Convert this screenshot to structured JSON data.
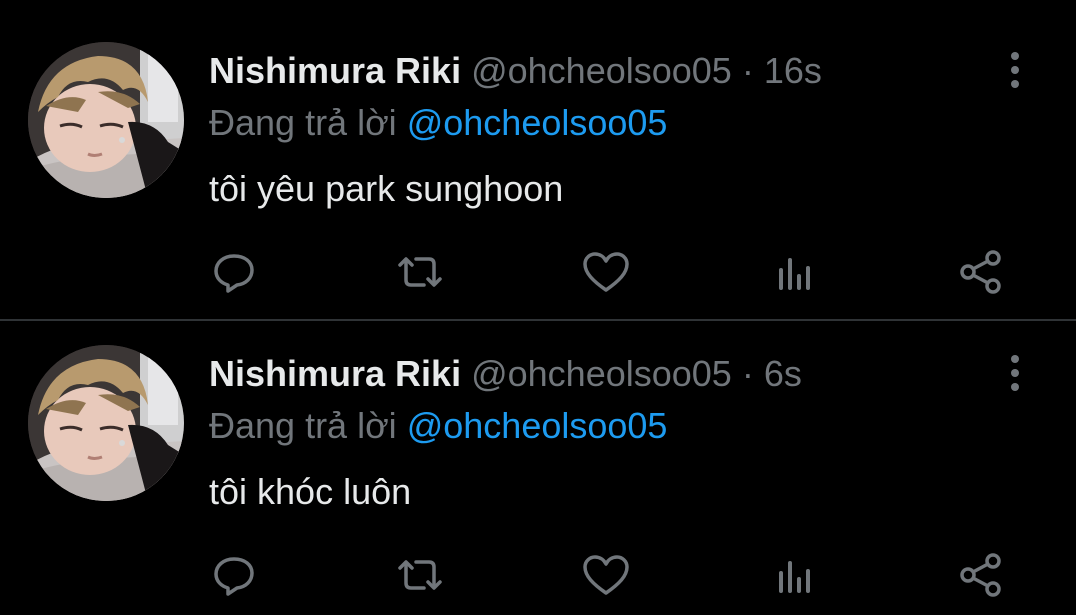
{
  "colors": {
    "background": "#000000",
    "primary_text": "#e7e9ea",
    "secondary_text": "#71767b",
    "mention": "#1d9bf0",
    "divider": "#2f3336"
  },
  "tweets": [
    {
      "author_name": "Nishimura Riki",
      "handle": "@ohcheolsoo05",
      "separator": "·",
      "time": "16s",
      "reply_prefix": "Đang trả lời",
      "reply_mention": "@ohcheolsoo05",
      "text": "tôi yêu park sunghoon",
      "avatar_icon": "user-avatar",
      "actions": [
        "reply-icon",
        "retweet-icon",
        "like-icon",
        "stats-icon",
        "share-icon"
      ]
    },
    {
      "author_name": "Nishimura Riki",
      "handle": "@ohcheolsoo05",
      "separator": "·",
      "time": "6s",
      "reply_prefix": "Đang trả lời",
      "reply_mention": "@ohcheolsoo05",
      "text": "tôi khóc luôn",
      "avatar_icon": "user-avatar",
      "actions": [
        "reply-icon",
        "retweet-icon",
        "like-icon",
        "stats-icon",
        "share-icon"
      ]
    }
  ]
}
